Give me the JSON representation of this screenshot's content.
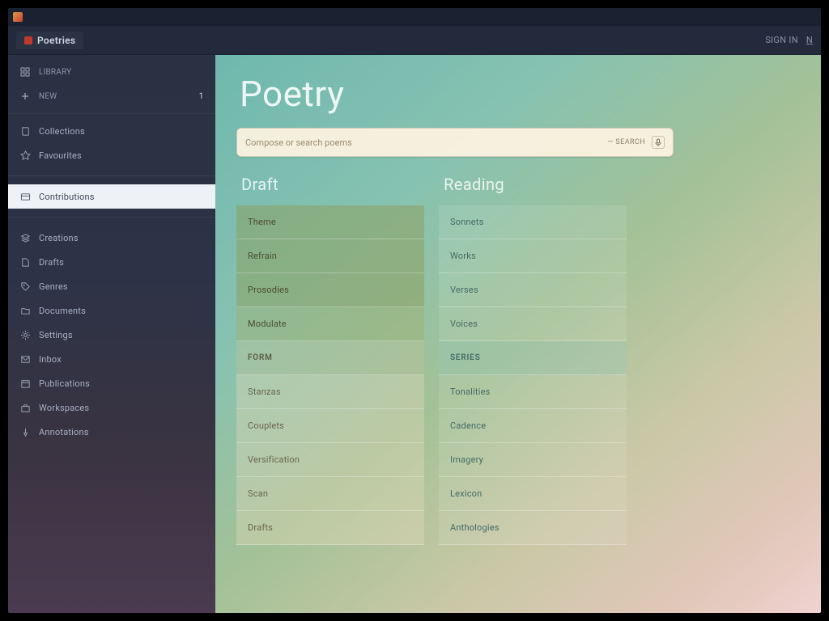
{
  "window": {
    "tab_title": "Poetries"
  },
  "topright": {
    "text1": "SIGN IN",
    "text2": "N"
  },
  "sidebar": {
    "top": [
      {
        "label": "LIBRARY",
        "icon": "grid"
      },
      {
        "label": "NEW",
        "icon": "plus",
        "badge": "1"
      }
    ],
    "groups": [
      [
        {
          "label": "Collections",
          "icon": "book"
        },
        {
          "label": "Favourites",
          "icon": "star"
        }
      ],
      [
        {
          "label": "Contributions",
          "icon": "card",
          "active": true
        }
      ],
      [
        {
          "label": "Creations",
          "icon": "layers"
        },
        {
          "label": "Drafts",
          "icon": "doc"
        },
        {
          "label": "Genres",
          "icon": "tag"
        },
        {
          "label": "Documents",
          "icon": "folder"
        },
        {
          "label": "Settings",
          "icon": "gear"
        },
        {
          "label": "Inbox",
          "icon": "mail"
        },
        {
          "label": "Publications",
          "icon": "calendar"
        },
        {
          "label": "Workspaces",
          "icon": "briefcase"
        },
        {
          "label": "Annotations",
          "icon": "pin"
        }
      ]
    ]
  },
  "page": {
    "title": "Poetry",
    "search": {
      "placeholder": "Compose or search poems",
      "hint": "— SEARCH"
    }
  },
  "columns": {
    "left": {
      "head": "Draft",
      "top": [
        "Theme",
        "Refrain",
        "Prosodies",
        "Modulate"
      ],
      "header": "FORM",
      "bottom": [
        "Stanzas",
        "Couplets",
        "Versification",
        "Scan",
        "Drafts"
      ]
    },
    "right": {
      "head": "Reading",
      "top": [
        "Sonnets",
        "Works",
        "Verses",
        "Voices"
      ],
      "header": "SERIES",
      "bottom": [
        "Tonalities",
        "Cadence",
        "Imagery",
        "Lexicon",
        "Anthologies"
      ]
    }
  }
}
